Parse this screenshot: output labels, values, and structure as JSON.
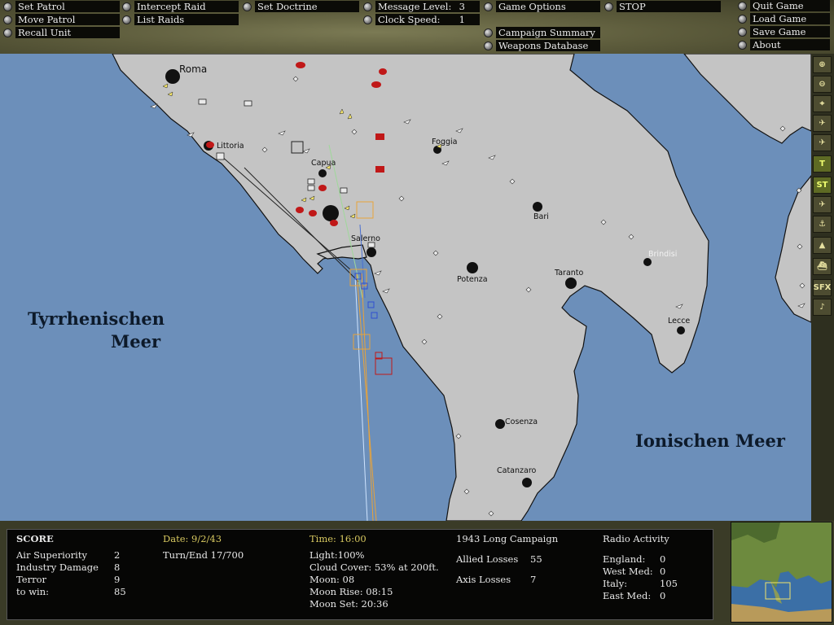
{
  "commands": {
    "set_patrol": "Set Patrol",
    "move_patrol": "Move Patrol",
    "recall_unit": "Recall Unit",
    "intercept_raid": "Intercept Raid",
    "list_raids": "List Raids",
    "set_doctrine": "Set Doctrine",
    "message_level_label": "Message Level:",
    "message_level_value": "3",
    "clock_speed_label": "Clock Speed:",
    "clock_speed_value": "1",
    "game_options": "Game Options",
    "stop": "STOP",
    "campaign_summary": "Campaign Summary",
    "weapons_database": "Weapons Database",
    "quit_game": "Quit Game",
    "load_game": "Load Game",
    "save_game": "Save Game",
    "about": "About"
  },
  "map": {
    "towns": [
      "Roma",
      "Littoria",
      "Capua",
      "Foggia",
      "Bari",
      "Salerno",
      "Potenza",
      "Taranto",
      "Brindisi",
      "Lecce",
      "Cosenza",
      "Catanzaro"
    ],
    "sea_west_1": "Tyrrhenischen",
    "sea_west_2": "Meer",
    "sea_east": "Ionischen Meer",
    "colors": {
      "sea": "#6c8fba",
      "land": "#c4c4c4",
      "allied": "#111111",
      "axis": "#c01818"
    }
  },
  "tools": [
    "zoom-in",
    "zoom-out",
    "center",
    "fighter-filter",
    "bomber-filter",
    "transport-filter",
    "ST",
    "airfield-filter",
    "port-filter",
    "factory-filter",
    "ship-filter",
    "SFX",
    "music"
  ],
  "status": {
    "score_label": "SCORE",
    "air_superiority_label": "Air Superiority",
    "air_superiority_value": "2",
    "industry_damage_label": "Industry Damage",
    "industry_damage_value": "8",
    "terror_label": "Terror",
    "terror_value": "9",
    "to_win_label": "to win:",
    "to_win_value": "85",
    "date": "Date: 9/2/43",
    "turn_end": "Turn/End 17/700",
    "time": "Time: 16:00",
    "light": "Light:100%",
    "cloud_cover": "Cloud Cover: 53% at 200ft.",
    "moon": "Moon: 08",
    "moon_rise": "Moon Rise: 08:15",
    "moon_set": "Moon Set: 20:36",
    "campaign": "1943 Long Campaign",
    "allied_losses_label": "Allied Losses",
    "allied_losses_value": "55",
    "axis_losses_label": "Axis Losses",
    "axis_losses_value": "7",
    "radio_activity_label": "Radio Activity",
    "radio": [
      {
        "region": "England:",
        "value": "0"
      },
      {
        "region": "West Med:",
        "value": "0"
      },
      {
        "region": "Italy:",
        "value": "105"
      },
      {
        "region": "East Med:",
        "value": "0"
      }
    ]
  }
}
